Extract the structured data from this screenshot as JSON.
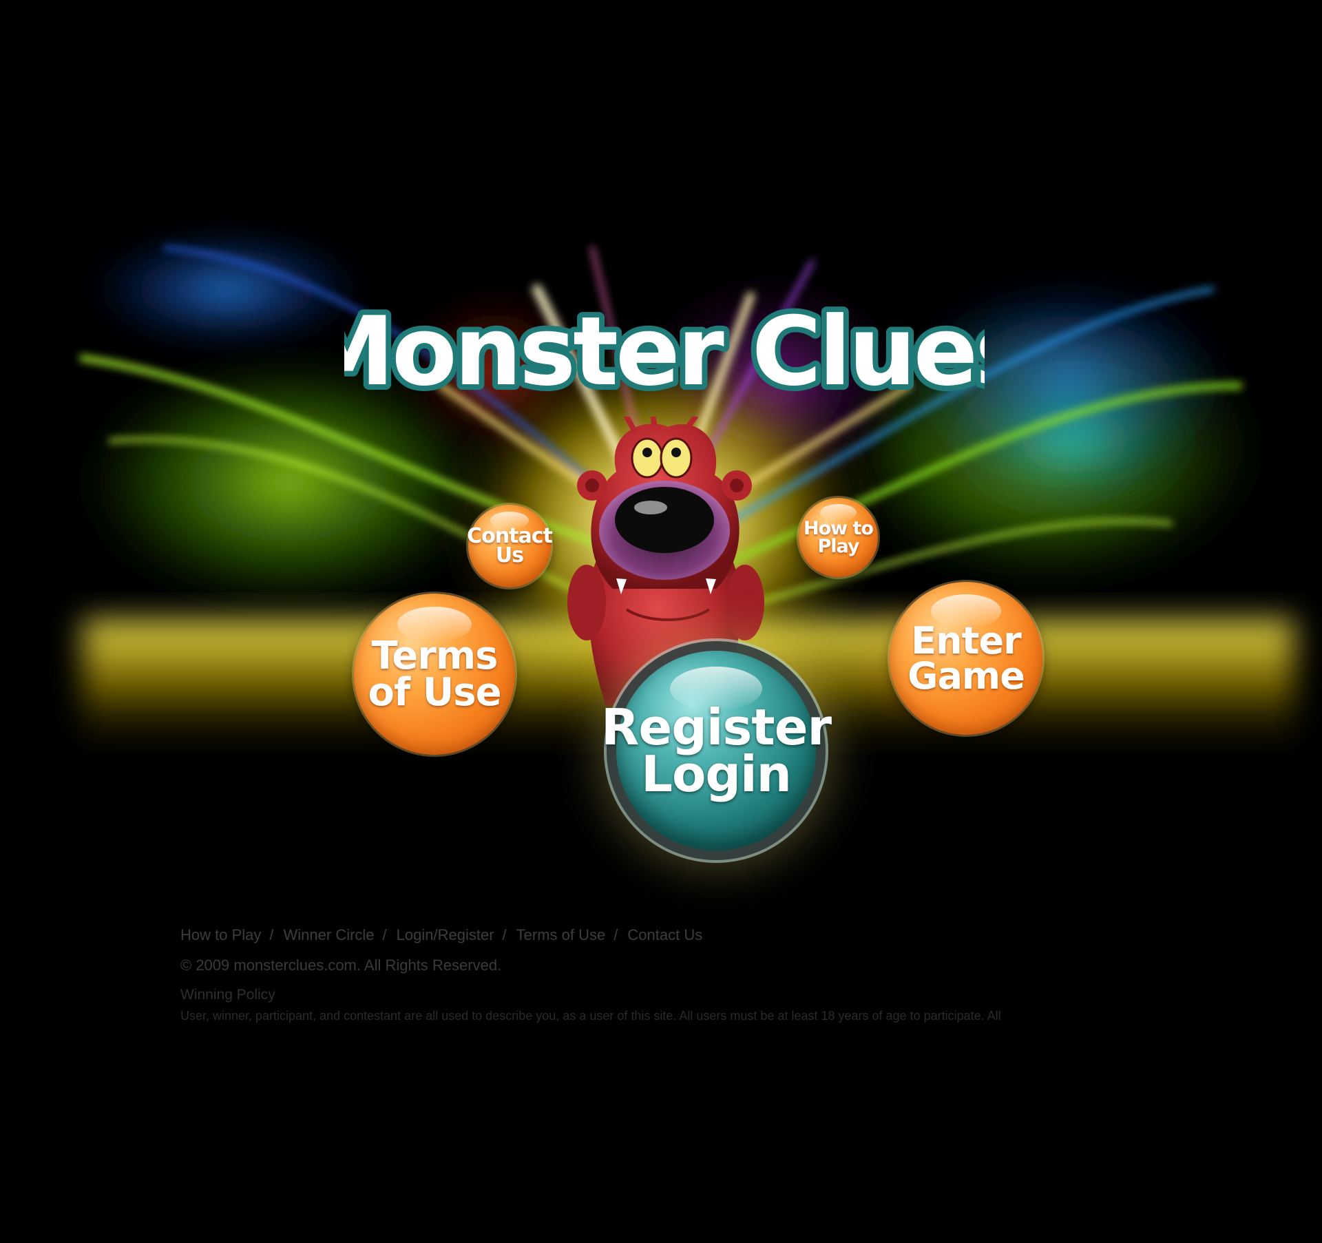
{
  "logo": {
    "text": "Monster Clues"
  },
  "buttons": {
    "contact_line1": "Contact",
    "contact_line2": "Us",
    "howto_line1": "How to",
    "howto_line2": "Play",
    "terms_line1": "Terms",
    "terms_line2": "of Use",
    "enter_line1": "Enter",
    "enter_line2": "Game",
    "register_line1": "Register",
    "register_line2": "Login"
  },
  "footer": {
    "nav": [
      {
        "label": "How to Play"
      },
      {
        "label": "Winner Circle"
      },
      {
        "label": "Login/Register"
      },
      {
        "label": "Terms of Use"
      },
      {
        "label": "Contact Us"
      }
    ],
    "separator": "/",
    "copyright": "© 2009 monsterclues.com. All Rights Reserved.",
    "policy_title": "Winning Policy",
    "policy_text": "User, winner, participant, and contestant are all used to describe you, as a user of this site. All users must be at least 18 years of age to participate. All"
  },
  "colors": {
    "background": "#000000",
    "bubble_orange": "#f6801e",
    "bubble_teal": "#217f7c",
    "logo_fill": "#ffffff",
    "logo_outline": "#1f7a78",
    "monster_body": "#b3262c",
    "footer_text": "#3d3d3d"
  }
}
